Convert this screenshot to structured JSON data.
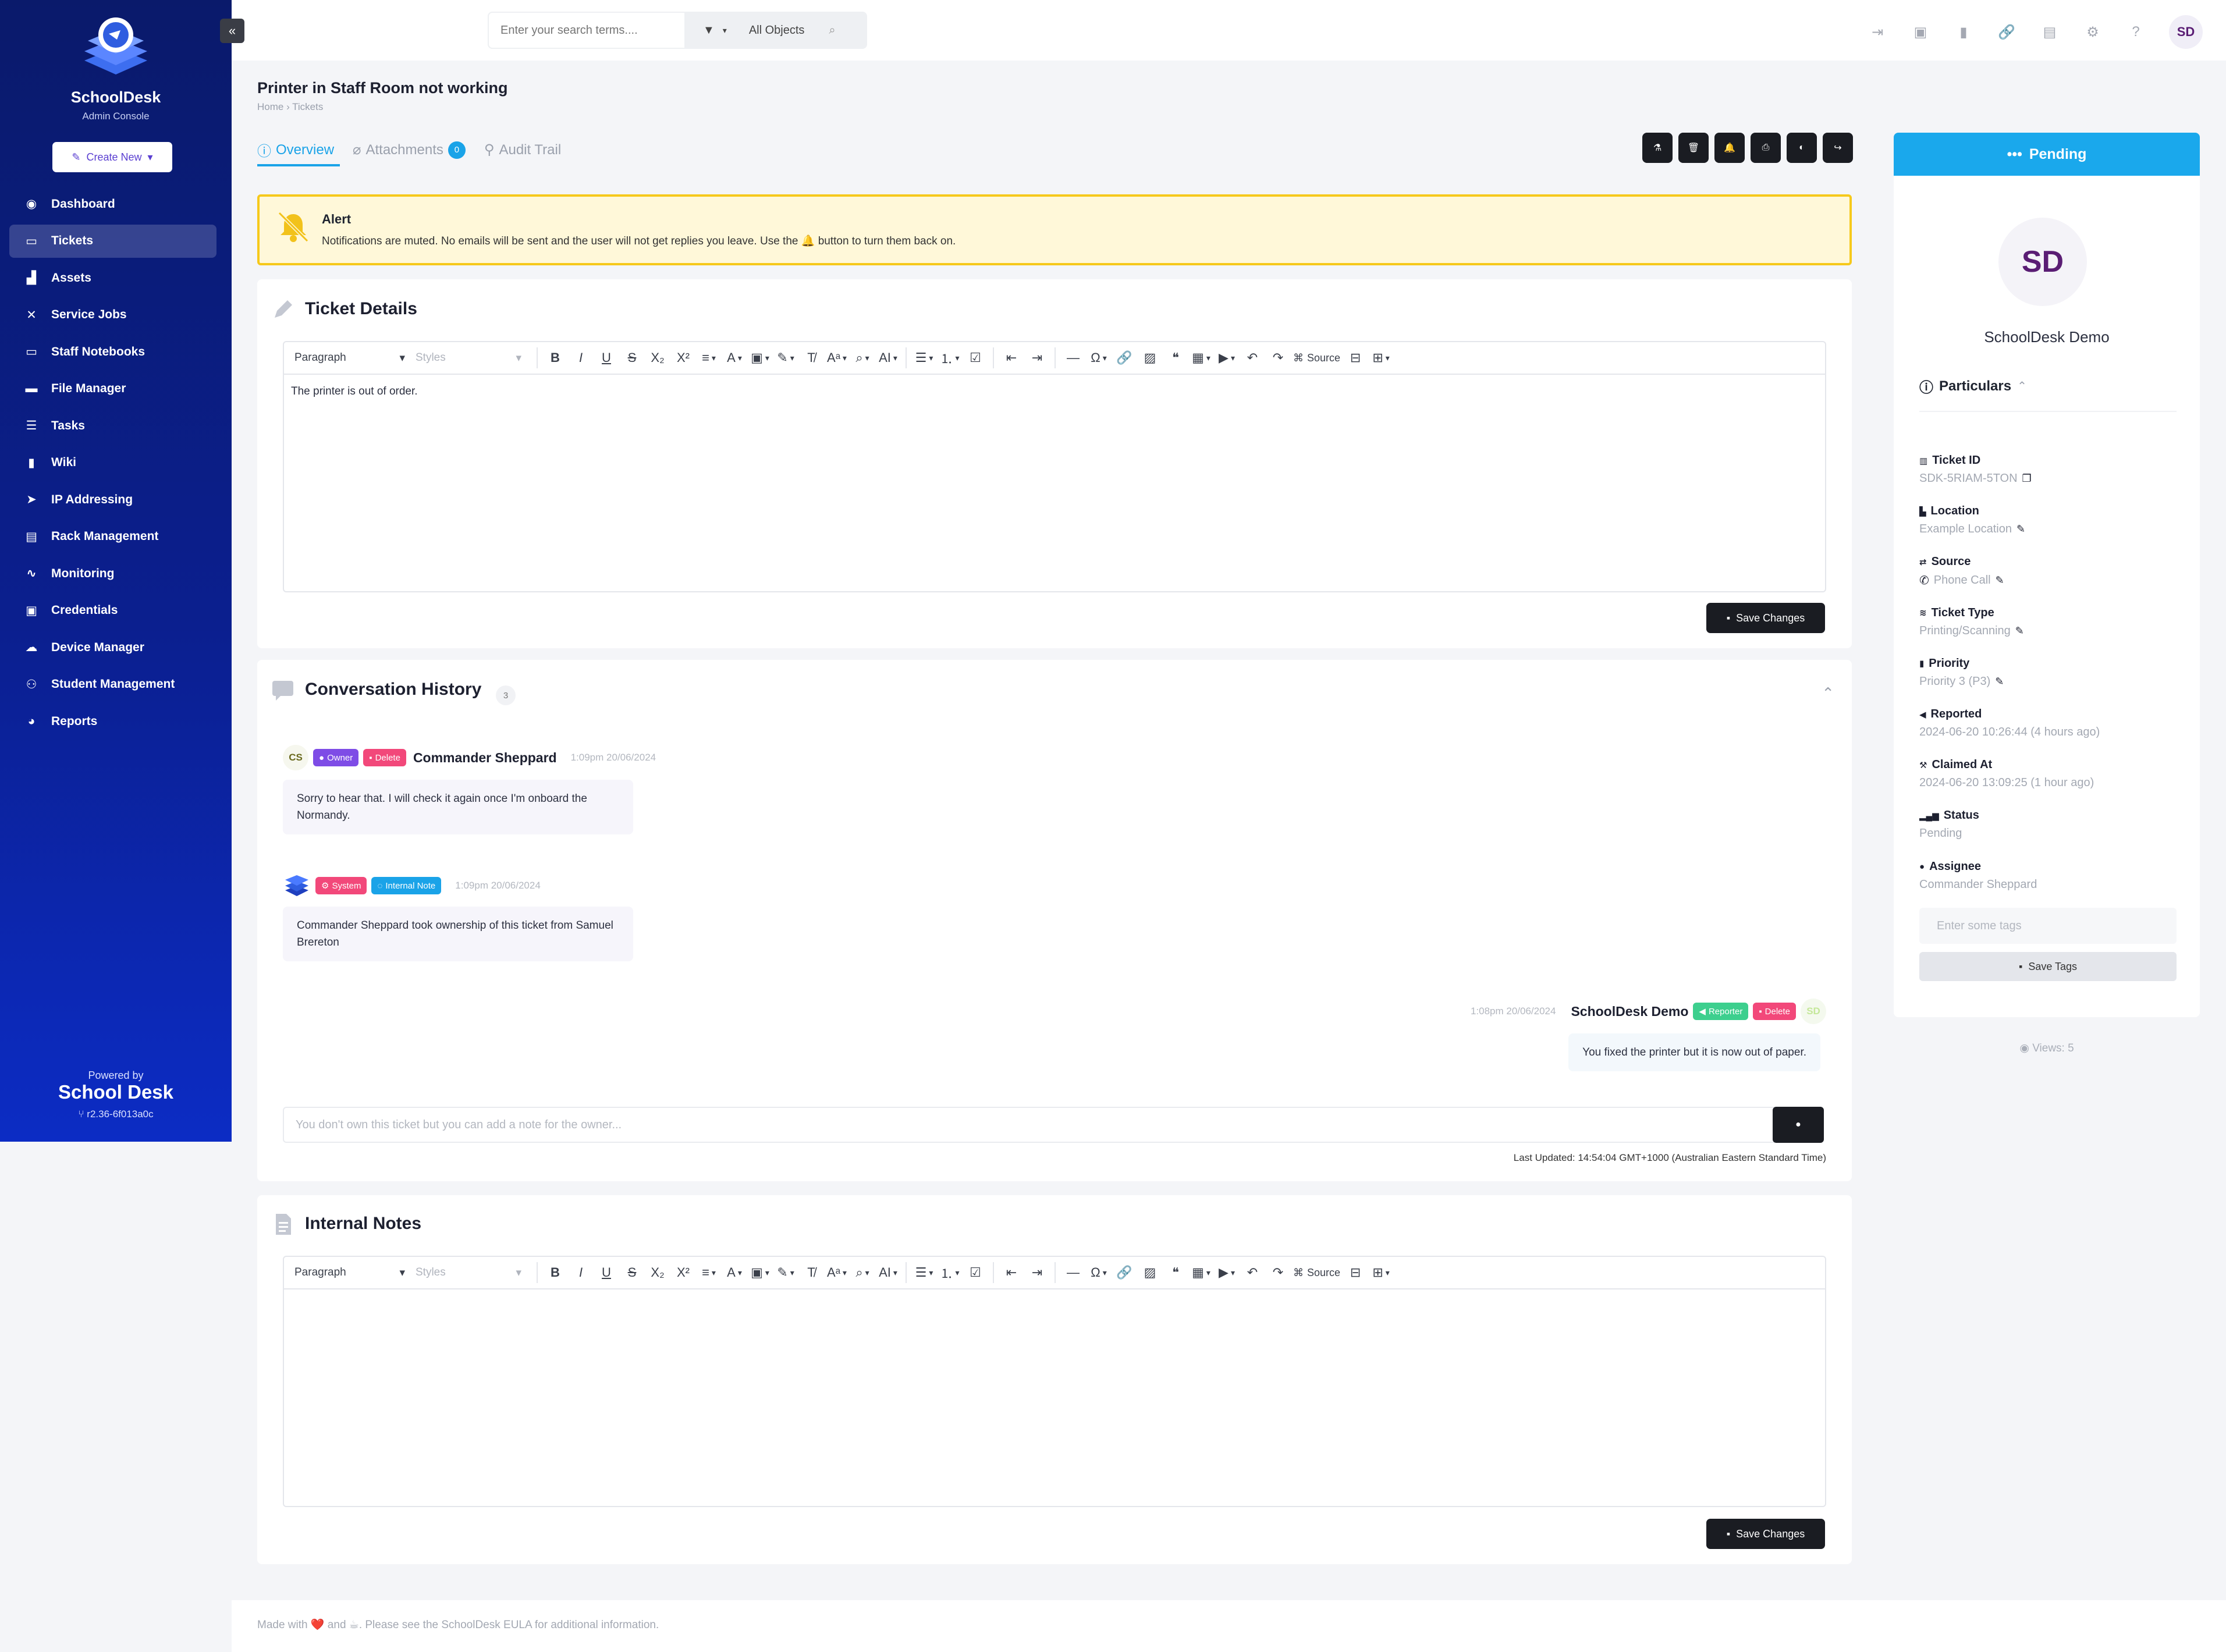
{
  "app": {
    "name": "SchoolDesk",
    "subtitle": "Admin Console",
    "create_label": "Create New",
    "powered_by": "Powered by",
    "brand": "School Desk",
    "version": "r2.36-6f013a0c"
  },
  "sidebar": {
    "items": [
      {
        "label": "Dashboard",
        "icon": "dashboard-icon"
      },
      {
        "label": "Tickets",
        "icon": "ticket-icon",
        "active": true
      },
      {
        "label": "Assets",
        "icon": "assets-icon"
      },
      {
        "label": "Service Jobs",
        "icon": "tools-icon"
      },
      {
        "label": "Staff Notebooks",
        "icon": "laptop-icon"
      },
      {
        "label": "File Manager",
        "icon": "folder-icon"
      },
      {
        "label": "Tasks",
        "icon": "tasks-icon"
      },
      {
        "label": "Wiki",
        "icon": "bookmark-icon"
      },
      {
        "label": "IP Addressing",
        "icon": "send-icon"
      },
      {
        "label": "Rack Management",
        "icon": "server-icon"
      },
      {
        "label": "Monitoring",
        "icon": "pulse-icon"
      },
      {
        "label": "Credentials",
        "icon": "id-card-icon"
      },
      {
        "label": "Device Manager",
        "icon": "cloud-icon"
      },
      {
        "label": "Student Management",
        "icon": "users-icon"
      },
      {
        "label": "Reports",
        "icon": "pie-icon"
      }
    ]
  },
  "topbar": {
    "search_placeholder": "Enter your search terms....",
    "filter_label": "All Objects",
    "avatar_initials": "SD"
  },
  "page": {
    "title": "Printer in Staff Room not working",
    "breadcrumb": "Home  ›  Tickets"
  },
  "tabs": [
    {
      "label": "Overview",
      "active": true
    },
    {
      "label": "Attachments",
      "badge": "0"
    },
    {
      "label": "Audit Trail"
    }
  ],
  "alert": {
    "title": "Alert",
    "text_before": "Notifications are muted. No emails will be sent and the user will not get replies you leave. Use the",
    "text_after": "button to turn them back on."
  },
  "ticket_details": {
    "title": "Ticket Details",
    "format_select": "Paragraph",
    "styles_select": "Styles",
    "source_label": "Source",
    "body": "The printer is out of order.",
    "save_label": "Save Changes"
  },
  "conversation": {
    "title": "Conversation History",
    "count": "3",
    "messages": [
      {
        "initials": "CS",
        "badges": [
          "Owner",
          "Delete"
        ],
        "name": "Commander Sheppard",
        "time": "1:09pm 20/06/2024",
        "text": "Sorry to hear that. I will check it again once I'm onboard the Normandy."
      },
      {
        "badges": [
          "System",
          "Internal Note"
        ],
        "time": "1:09pm 20/06/2024",
        "text": "Commander Sheppard took ownership of this ticket from Samuel Brereton"
      },
      {
        "initials": "SD",
        "badges": [
          "Reporter",
          "Delete"
        ],
        "name": "SchoolDesk Demo",
        "time": "1:08pm 20/06/2024",
        "text": "You fixed the printer but it is now out of paper."
      }
    ],
    "note_placeholder": "You don't own this ticket but you can add a note for the owner...",
    "last_updated": "Last Updated: 14:54:04 GMT+1000 (Australian Eastern Standard Time)"
  },
  "internal_notes": {
    "title": "Internal Notes",
    "format_select": "Paragraph",
    "styles_select": "Styles",
    "source_label": "Source",
    "save_label": "Save Changes"
  },
  "side": {
    "status": "Pending",
    "avatar_initials": "SD",
    "name": "SchoolDesk Demo",
    "particulars_label": "Particulars",
    "fields": [
      {
        "label": "Ticket ID",
        "value": "SDK-5RIAM-5TON"
      },
      {
        "label": "Location",
        "value": "Example Location"
      },
      {
        "label": "Source",
        "value": "Phone Call"
      },
      {
        "label": "Ticket Type",
        "value": "Printing/Scanning"
      },
      {
        "label": "Priority",
        "value": "Priority 3 (P3)"
      },
      {
        "label": "Reported",
        "value": "2024-06-20 10:26:44 (4 hours ago)"
      },
      {
        "label": "Claimed At",
        "value": "2024-06-20 13:09:25 (1 hour ago)"
      },
      {
        "label": "Status",
        "value": "Pending"
      },
      {
        "label": "Assignee",
        "value": "Commander Sheppard"
      }
    ],
    "tags_placeholder": "Enter some tags",
    "tags_save": "Save Tags",
    "views": "Views: 5"
  },
  "footer": {
    "text": "Made with ❤️ and ☕. Please see the SchoolDesk EULA for additional information."
  },
  "colors": {
    "sidebar": "#0b1f8f",
    "accent": "#1aa3e8",
    "pending": "#1aa8ec",
    "alert_border": "#f6c91b"
  }
}
